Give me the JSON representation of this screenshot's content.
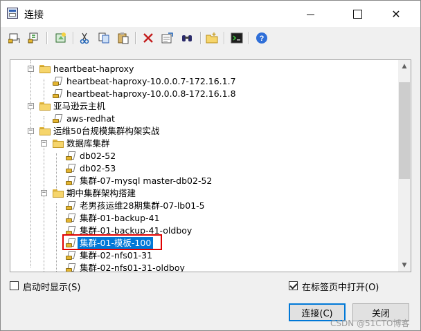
{
  "window": {
    "title": "连接"
  },
  "toolbar": {
    "items": [
      "connect-icon",
      "quick-connect-icon",
      "new-session-icon",
      "cut-icon",
      "copy-icon",
      "paste-icon",
      "delete-icon",
      "properties-icon",
      "find-icon",
      "new-folder-icon",
      "terminal-icon",
      "help-icon"
    ]
  },
  "tree": {
    "nodes": [
      {
        "label": "heartbeat-haproxy",
        "type": "folder"
      },
      {
        "label": "heartbeat-haproxy-10.0.0.7-172.16.1.7",
        "type": "session"
      },
      {
        "label": "heartbeat-haproxy-10.0.0.8-172.16.1.8",
        "type": "session"
      },
      {
        "label": "亚马逊云主机",
        "type": "folder"
      },
      {
        "label": "aws-redhat",
        "type": "session"
      },
      {
        "label": "运维50台规模集群构架实战",
        "type": "folder"
      },
      {
        "label": "数据库集群",
        "type": "folder"
      },
      {
        "label": "db02-52",
        "type": "session"
      },
      {
        "label": "db02-53",
        "type": "session"
      },
      {
        "label": "集群-07-mysql master-db02-52",
        "type": "session"
      },
      {
        "label": "期中集群架构搭建",
        "type": "folder"
      },
      {
        "label": "老男孩运维28期集群-07-lb01-5",
        "type": "session"
      },
      {
        "label": "集群-01-backup-41",
        "type": "session"
      },
      {
        "label": "集群-01-backup-41-oldboy",
        "type": "session"
      },
      {
        "label": "集群-01-模板-100",
        "type": "session",
        "selected": true
      },
      {
        "label": "集群-02-nfs01-31",
        "type": "session"
      },
      {
        "label": "集群-02-nfs01-31-oldboy",
        "type": "session"
      }
    ],
    "expand_symbol": "−"
  },
  "options": {
    "show_on_startup": {
      "label": "启动时显示(S)",
      "checked": false
    },
    "open_in_tab": {
      "label": "在标签页中打开(O)",
      "checked": true
    }
  },
  "buttons": {
    "connect": "连接(C)",
    "close": "关闭"
  },
  "watermark": "CSDN @51CTO博客"
}
